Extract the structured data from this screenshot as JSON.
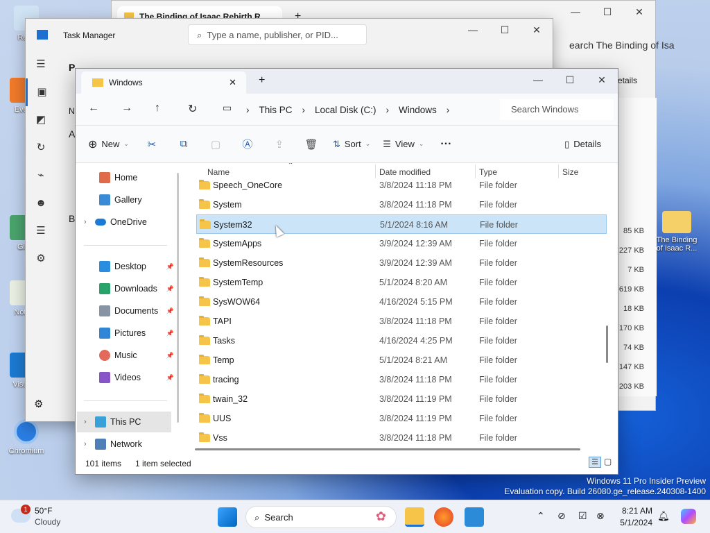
{
  "desktop": {
    "icons": [
      {
        "label": "Recy"
      },
      {
        "label": "Ever"
      },
      {
        "label": "Git"
      },
      {
        "label": "Note"
      },
      {
        "label": "Visua"
      },
      {
        "label": "Chromium"
      },
      {
        "label": "The Binding of Isaac R..."
      }
    ],
    "watermark": {
      "line1": "Windows 11 Pro Insider Preview",
      "line2": "Evaluation copy. Build 26080.ge_release.240308-1400"
    }
  },
  "browser": {
    "tab_title": "The Binding of Isaac Rebirth R",
    "search_text": "earch The Binding of Isa",
    "details": "etails",
    "sizes": [
      "85 KB",
      "227 KB",
      "7 KB",
      "619 KB",
      "18 KB",
      "170 KB",
      "74 KB",
      "147 KB",
      "203 KB"
    ]
  },
  "taskmanager": {
    "title": "Task Manager",
    "search_placeholder": "Type a name, publisher, or PID...",
    "side_letters": [
      "P",
      "N",
      "A",
      "B"
    ]
  },
  "explorer": {
    "tab_title": "Windows",
    "breadcrumb": [
      "This PC",
      "Local Disk (C:)",
      "Windows"
    ],
    "search_placeholder": "Search Windows",
    "commands": {
      "new": "New",
      "sort": "Sort",
      "view": "View",
      "details": "Details"
    },
    "nav": [
      {
        "label": "Home"
      },
      {
        "label": "Gallery"
      },
      {
        "label": "OneDrive"
      },
      {
        "label": "Desktop"
      },
      {
        "label": "Downloads"
      },
      {
        "label": "Documents"
      },
      {
        "label": "Pictures"
      },
      {
        "label": "Music"
      },
      {
        "label": "Videos"
      },
      {
        "label": "This PC"
      },
      {
        "label": "Network"
      }
    ],
    "columns": {
      "name": "Name",
      "date": "Date modified",
      "type": "Type",
      "size": "Size"
    },
    "rows": [
      {
        "name": "Speech_OneCore",
        "date": "3/8/2024 11:18 PM",
        "type": "File folder"
      },
      {
        "name": "System",
        "date": "3/8/2024 11:18 PM",
        "type": "File folder"
      },
      {
        "name": "System32",
        "date": "5/1/2024 8:16 AM",
        "type": "File folder"
      },
      {
        "name": "SystemApps",
        "date": "3/9/2024 12:39 AM",
        "type": "File folder"
      },
      {
        "name": "SystemResources",
        "date": "3/9/2024 12:39 AM",
        "type": "File folder"
      },
      {
        "name": "SystemTemp",
        "date": "5/1/2024 8:20 AM",
        "type": "File folder"
      },
      {
        "name": "SysWOW64",
        "date": "4/16/2024 5:15 PM",
        "type": "File folder"
      },
      {
        "name": "TAPI",
        "date": "3/8/2024 11:18 PM",
        "type": "File folder"
      },
      {
        "name": "Tasks",
        "date": "4/16/2024 4:25 PM",
        "type": "File folder"
      },
      {
        "name": "Temp",
        "date": "5/1/2024 8:21 AM",
        "type": "File folder"
      },
      {
        "name": "tracing",
        "date": "3/8/2024 11:18 PM",
        "type": "File folder"
      },
      {
        "name": "twain_32",
        "date": "3/8/2024 11:19 PM",
        "type": "File folder"
      },
      {
        "name": "UUS",
        "date": "3/8/2024 11:19 PM",
        "type": "File folder"
      },
      {
        "name": "Vss",
        "date": "3/8/2024 11:18 PM",
        "type": "File folder"
      }
    ],
    "selected_row": "System32",
    "status": {
      "count": "101 items",
      "selected": "1 item selected"
    }
  },
  "taskbar": {
    "weather_temp": "50°F",
    "weather_desc": "Cloudy",
    "weather_badge": "1",
    "search": "Search",
    "time": "8:21 AM",
    "date": "5/1/2024"
  }
}
